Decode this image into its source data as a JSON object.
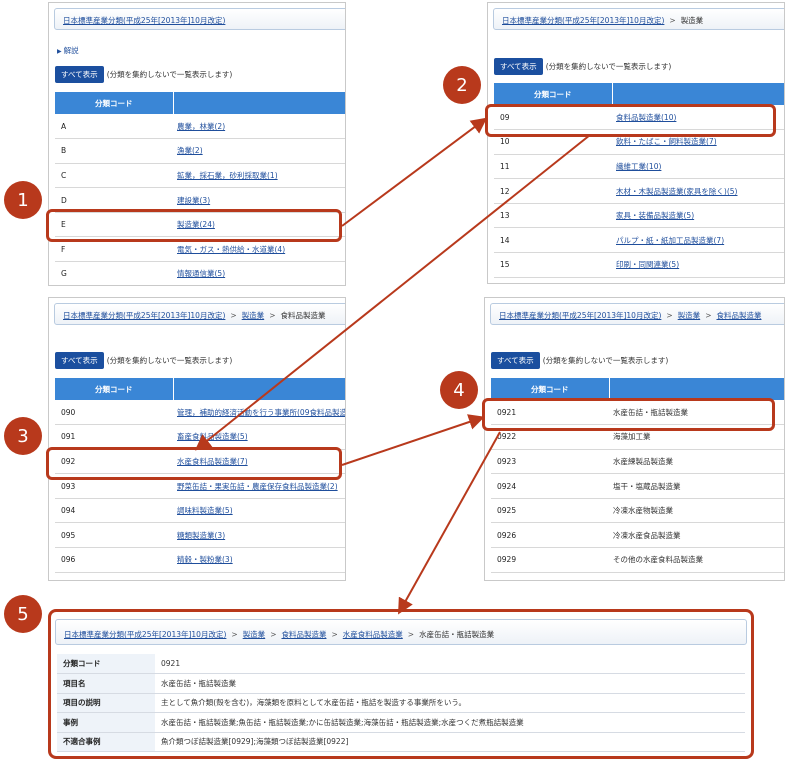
{
  "steps": [
    "1",
    "2",
    "3",
    "4",
    "5"
  ],
  "common": {
    "show_all_button": "すべて表示",
    "show_all_note": "(分類を集約しないで一覧表示します)",
    "code_header": "分類コード",
    "name_header": "",
    "separator": ">"
  },
  "panel1": {
    "breadcrumb": {
      "root": "日本標準産業分類(平成25年[2013年]10月改定)"
    },
    "toggle_label": "解説",
    "rows": [
      {
        "code": "A",
        "name": "農業，林業(2)"
      },
      {
        "code": "B",
        "name": "漁業(2)"
      },
      {
        "code": "C",
        "name": "鉱業，採石業，砂利採取業(1)"
      },
      {
        "code": "D",
        "name": "建設業(3)"
      },
      {
        "code": "E",
        "name": "製造業(24)"
      },
      {
        "code": "F",
        "name": "電気・ガス・熱供給・水道業(4)"
      },
      {
        "code": "G",
        "name": "情報通信業(5)"
      }
    ]
  },
  "panel2": {
    "breadcrumb": {
      "root": "日本標準産業分類(平成25年[2013年]10月改定)",
      "current": "製造業"
    },
    "rows": [
      {
        "code": "09",
        "name": "食料品製造業(10)"
      },
      {
        "code": "10",
        "name": "飲料・たばこ・飼料製造業(7)"
      },
      {
        "code": "11",
        "name": "繊維工業(10)"
      },
      {
        "code": "12",
        "name": "木材・木製品製造業(家具を除く)(5)"
      },
      {
        "code": "13",
        "name": "家具・装備品製造業(5)"
      },
      {
        "code": "14",
        "name": "パルプ・紙・紙加工品製造業(7)"
      },
      {
        "code": "15",
        "name": "印刷・同関連業(5)"
      }
    ]
  },
  "panel3": {
    "breadcrumb": {
      "root": "日本標準産業分類(平成25年[2013年]10月改定)",
      "level1": "製造業",
      "current": "食料品製造業"
    },
    "rows": [
      {
        "code": "090",
        "name": "管理，補助的経済活動を行う事業所(09食料品製造業)"
      },
      {
        "code": "091",
        "name": "畜産食料品製造業(5)"
      },
      {
        "code": "092",
        "name": "水産食料品製造業(7)"
      },
      {
        "code": "093",
        "name": "野菜缶詰・果実缶詰・農産保存食料品製造業(2)"
      },
      {
        "code": "094",
        "name": "調味料製造業(5)"
      },
      {
        "code": "095",
        "name": "糖類製造業(3)"
      },
      {
        "code": "096",
        "name": "精穀・製粉業(3)"
      }
    ]
  },
  "panel4": {
    "breadcrumb": {
      "root": "日本標準産業分類(平成25年[2013年]10月改定)",
      "level1": "製造業",
      "current": "食料品製造業"
    },
    "rows": [
      {
        "code": "0921",
        "name": "水産缶詰・瓶詰製造業"
      },
      {
        "code": "0922",
        "name": "海藻加工業"
      },
      {
        "code": "0923",
        "name": "水産練製品製造業"
      },
      {
        "code": "0924",
        "name": "塩干・塩蔵品製造業"
      },
      {
        "code": "0925",
        "name": "冷凍水産物製造業"
      },
      {
        "code": "0926",
        "name": "冷凍水産食品製造業"
      },
      {
        "code": "0929",
        "name": "その他の水産食料品製造業"
      }
    ]
  },
  "detail": {
    "breadcrumb": {
      "root": "日本標準産業分類(平成25年[2013年]10月改定)",
      "level1": "製造業",
      "level2": "食料品製造業",
      "level3": "水産食料品製造業",
      "current": "水産缶詰・瓶詰製造業"
    },
    "rows": [
      {
        "label": "分類コード",
        "value": "0921"
      },
      {
        "label": "項目名",
        "value": "水産缶詰・瓶詰製造業"
      },
      {
        "label": "項目の説明",
        "value": "主として魚介類(殻を含む)，海藻類を原料として水産缶詰・瓶詰を製造する事業所をいう。"
      },
      {
        "label": "事例",
        "value": "水産缶詰・瓶詰製造業;魚缶詰・瓶詰製造業;かに缶詰製造業;海藻缶詰・瓶詰製造業;水産つくだ煮瓶詰製造業"
      },
      {
        "label": "不適合事例",
        "value": "魚介類つぼ詰製造業[0929];海藻類つぼ詰製造業[0922]"
      }
    ]
  },
  "colors": {
    "accent": "#b8391c",
    "header_blue": "#3a86d6",
    "button_blue": "#1b4f9f",
    "link": "#1f4e9c"
  }
}
